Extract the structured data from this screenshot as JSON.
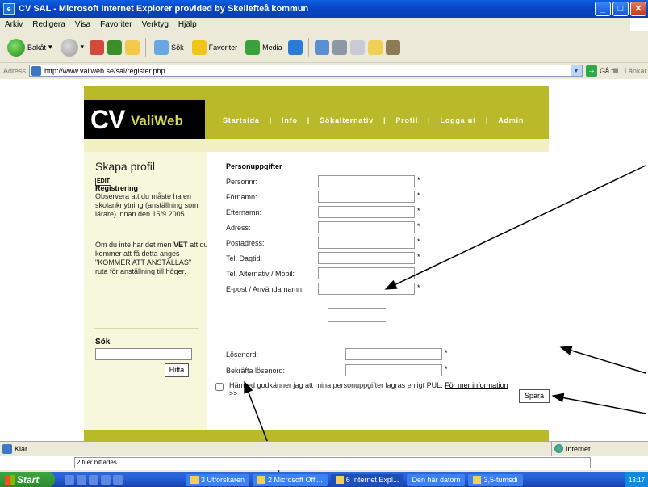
{
  "window": {
    "title": "CV SAL - Microsoft Internet Explorer provided by Skellefteå kommun",
    "min": "_",
    "max": "□",
    "close": "✕"
  },
  "menu": [
    "Arkiv",
    "Redigera",
    "Visa",
    "Favoriter",
    "Verktyg",
    "Hjälp"
  ],
  "toolbar": {
    "back": "Bakåt",
    "search": "Sök",
    "favorites": "Favoriter",
    "media": "Media"
  },
  "address": {
    "label": "Adress",
    "url": "http://www.valiweb.se/sal/register.php",
    "go": "Gå till",
    "links": "Länkar"
  },
  "site": {
    "logo_cv": "CV",
    "logo_name": "ValiWeb",
    "nav": [
      "Startsida",
      "Info",
      "Sökalternativ",
      "Profil",
      "Logga ut",
      "Admin"
    ]
  },
  "left": {
    "title": "Skapa profil",
    "edit_tag": "EDIT",
    "reg_title": "Registrering",
    "reg_text": "Observera att du måste ha en skolanknytning (anställning som lärare) innan den 15/9 2005.",
    "info_pre": "Om du inte har det men ",
    "info_bold": "VET",
    "info_post": " att du kommer att få detta anges \"KOMMER ATT ANSTÄLLAS\" i ruta för anställning till höger.",
    "search_title": "Sök",
    "search_button": "Hitta"
  },
  "form": {
    "title": "Personuppgifter",
    "fields": [
      {
        "label": "Personnr:",
        "value": ""
      },
      {
        "label": "Förnamn:",
        "value": ""
      },
      {
        "label": "Efternamn:",
        "value": ""
      },
      {
        "label": "Adress:",
        "value": ""
      },
      {
        "label": "Postadress:",
        "value": ""
      },
      {
        "label": "Tel. Dagtid:",
        "value": ""
      },
      {
        "label": "Tel. Alternativ / Mobil:",
        "value": ""
      },
      {
        "label": "E-post / Användarnamn:",
        "value": ""
      }
    ],
    "required_mark": "*",
    "password_label": "Lösenord:",
    "password_confirm_label": "Bekräfta lösenord:",
    "pul_text": "Härmed godkänner jag att mina personuppgifter lagras enligt PUL. ",
    "pul_link": "För mer information >>",
    "save_button": "Spara"
  },
  "status": {
    "text": "Klar",
    "zone": "Internet"
  },
  "tooltip": "2 filer hittades",
  "taskbar": {
    "start": "Start",
    "tasks": [
      "3 Utforskaren",
      "2 Microsoft Offi...",
      "6 Internet Expl...",
      "Den här datorn",
      "3,5-tumsdi"
    ],
    "clock": "13:17"
  }
}
